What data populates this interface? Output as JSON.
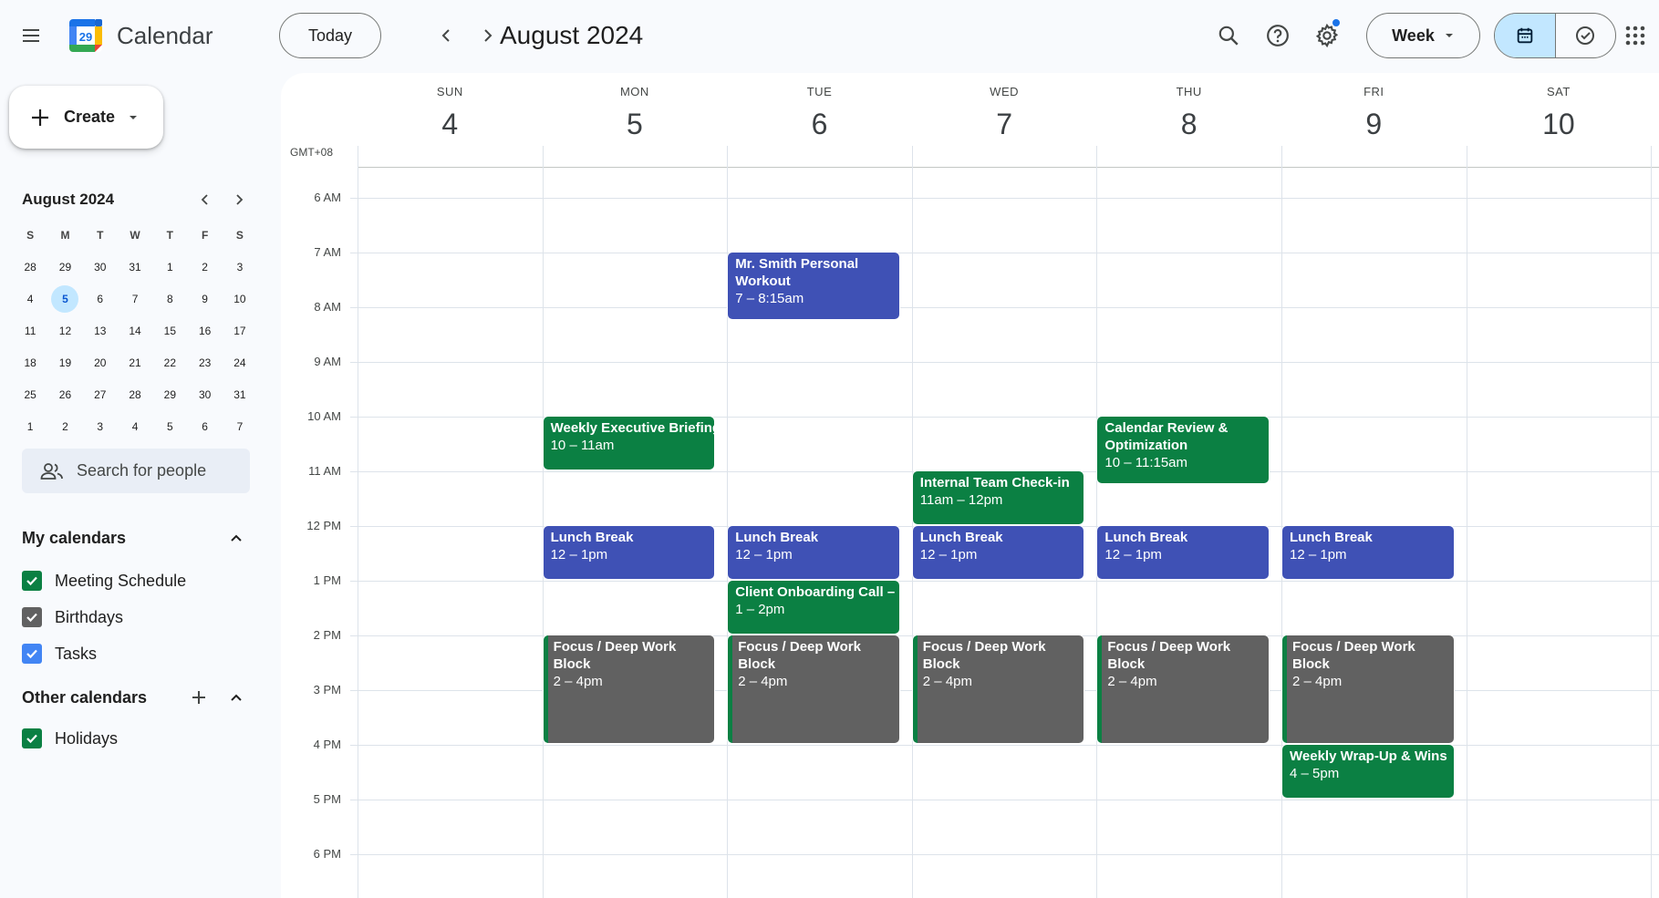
{
  "app": {
    "title": "Calendar",
    "logo_day": "29"
  },
  "toolbar": {
    "today_label": "Today",
    "current_period": "August 2024",
    "view_label": "Week",
    "icons": [
      "menu-icon",
      "search-icon",
      "help-icon",
      "settings-icon",
      "calendar-view-icon",
      "tasks-view-icon",
      "apps-grid-icon"
    ]
  },
  "sidebar": {
    "create_label": "Create",
    "mini_calendar": {
      "title": "August 2024",
      "weekday_headers": [
        "S",
        "M",
        "T",
        "W",
        "T",
        "F",
        "S"
      ],
      "weeks": [
        [
          "28",
          "29",
          "30",
          "31",
          "1",
          "2",
          "3"
        ],
        [
          "4",
          "5",
          "6",
          "7",
          "8",
          "9",
          "10"
        ],
        [
          "11",
          "12",
          "13",
          "14",
          "15",
          "16",
          "17"
        ],
        [
          "18",
          "19",
          "20",
          "21",
          "22",
          "23",
          "24"
        ],
        [
          "25",
          "26",
          "27",
          "28",
          "29",
          "30",
          "31"
        ],
        [
          "1",
          "2",
          "3",
          "4",
          "5",
          "6",
          "7"
        ]
      ],
      "selected_day": "5"
    },
    "search_people_placeholder": "Search for people",
    "my_calendars": {
      "title": "My calendars",
      "items": [
        {
          "label": "Meeting Schedule",
          "color": "#0b8043",
          "checked": true
        },
        {
          "label": "Birthdays",
          "color": "#616161",
          "checked": true
        },
        {
          "label": "Tasks",
          "color": "#4285f4",
          "checked": true
        }
      ]
    },
    "other_calendars": {
      "title": "Other calendars",
      "items": [
        {
          "label": "Holidays",
          "color": "#0b8043",
          "checked": true
        }
      ]
    }
  },
  "week": {
    "timezone": "GMT+08",
    "days": [
      {
        "dow": "SUN",
        "date": "4"
      },
      {
        "dow": "MON",
        "date": "5"
      },
      {
        "dow": "TUE",
        "date": "6"
      },
      {
        "dow": "WED",
        "date": "7"
      },
      {
        "dow": "THU",
        "date": "8"
      },
      {
        "dow": "FRI",
        "date": "9"
      },
      {
        "dow": "SAT",
        "date": "10"
      }
    ],
    "hours": [
      "6 AM",
      "7 AM",
      "8 AM",
      "9 AM",
      "10 AM",
      "11 AM",
      "12 PM",
      "1 PM",
      "2 PM",
      "3 PM",
      "4 PM",
      "5 PM",
      "6 PM"
    ],
    "events": [
      {
        "day": 2,
        "start": 7,
        "end": 8.25,
        "title": "Mr. Smith Personal Workout",
        "time": "7 – 8:15am",
        "style": "blue"
      },
      {
        "day": 1,
        "start": 10,
        "end": 11,
        "title": "Weekly Executive Briefing",
        "time": "10 – 11am",
        "style": "green"
      },
      {
        "day": 4,
        "start": 10,
        "end": 11.25,
        "title": "Calendar Review & Optimization",
        "time": "10 – 11:15am",
        "style": "green"
      },
      {
        "day": 3,
        "start": 11,
        "end": 12,
        "title": "Internal Team Check-in",
        "time": "11am – 12pm",
        "style": "green"
      },
      {
        "day": 1,
        "start": 12,
        "end": 13,
        "title": "Lunch Break",
        "time": "12 – 1pm",
        "style": "blue"
      },
      {
        "day": 2,
        "start": 12,
        "end": 13,
        "title": "Lunch Break",
        "time": "12 – 1pm",
        "style": "blue"
      },
      {
        "day": 3,
        "start": 12,
        "end": 13,
        "title": "Lunch Break",
        "time": "12 – 1pm",
        "style": "blue"
      },
      {
        "day": 4,
        "start": 12,
        "end": 13,
        "title": "Lunch Break",
        "time": "12 – 1pm",
        "style": "blue"
      },
      {
        "day": 5,
        "start": 12,
        "end": 13,
        "title": "Lunch Break",
        "time": "12 – 1pm",
        "style": "blue"
      },
      {
        "day": 2,
        "start": 13,
        "end": 14,
        "title": "Client Onboarding Call –",
        "time": "1 – 2pm",
        "style": "green"
      },
      {
        "day": 1,
        "start": 14,
        "end": 16,
        "title": "Focus / Deep Work Block",
        "time": "2 – 4pm",
        "style": "gray"
      },
      {
        "day": 2,
        "start": 14,
        "end": 16,
        "title": "Focus / Deep Work Block",
        "time": "2 – 4pm",
        "style": "gray"
      },
      {
        "day": 3,
        "start": 14,
        "end": 16,
        "title": "Focus / Deep Work Block",
        "time": "2 – 4pm",
        "style": "gray"
      },
      {
        "day": 4,
        "start": 14,
        "end": 16,
        "title": "Focus / Deep Work Block",
        "time": "2 – 4pm",
        "style": "gray"
      },
      {
        "day": 5,
        "start": 14,
        "end": 16,
        "title": "Focus / Deep Work Block",
        "time": "2 – 4pm",
        "style": "gray"
      },
      {
        "day": 5,
        "start": 16,
        "end": 17,
        "title": "Weekly Wrap-Up & Wins",
        "time": "4 – 5pm",
        "style": "green"
      }
    ]
  }
}
